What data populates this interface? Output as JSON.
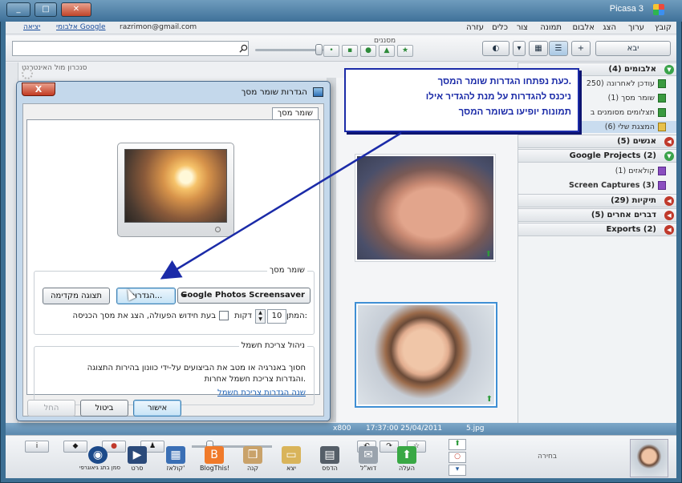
{
  "window": {
    "title": "Picasa 3",
    "min_glyph": "_",
    "max_glyph": "□",
    "close_glyph": "✕"
  },
  "menu": [
    "קובץ",
    "ערוך",
    "הצג",
    "אלבום",
    "תמונה",
    "צור",
    "כלים",
    "עזרה"
  ],
  "account": {
    "email": "razrimon@gmail.com",
    "albums_link": "אלבומי Google",
    "logout_link": "יציאה"
  },
  "toolbar": {
    "filters_label": "מסננים",
    "import_label": "יבא",
    "internet_sync_label": "סנכרון מול האינטרנט"
  },
  "sidebar": {
    "sections": [
      {
        "label": "אלבומים (4)",
        "state": "open"
      },
      {
        "label": "אנשים (5)",
        "state": "closed"
      },
      {
        "label": "Google Projects (2)",
        "state": "open"
      },
      {
        "label": "תיקיות (29)",
        "state": "closed"
      },
      {
        "label": "דברים אחרים (5)",
        "state": "closed"
      },
      {
        "label": "Exports (2)",
        "state": "closed"
      }
    ],
    "albums": [
      {
        "label": "עודכן לאחרונה (250"
      },
      {
        "label": "שומר מסך (1)"
      },
      {
        "label": "תצלומים מסומנים ב"
      },
      {
        "label": "המצגת שלי (6)"
      }
    ],
    "projects": [
      {
        "label": "קולאזים (1)"
      },
      {
        "label": "Screen Captures (3)"
      }
    ]
  },
  "status": {
    "dims": "x800",
    "datetime": "17:37:00 25/04/2011",
    "filename": "5.jpg"
  },
  "bottom": {
    "tray_label": "בחירה",
    "actions": [
      {
        "label": "העלה",
        "icon": "upload-icon",
        "color": "#39a845"
      },
      {
        "label": "דוא\"ל",
        "icon": "email-icon",
        "color": "#9aa3ad"
      },
      {
        "label": "הדפס",
        "icon": "printer-icon",
        "color": "#555e68"
      },
      {
        "label": "יצא",
        "icon": "folder-icon",
        "color": "#d9b45a"
      },
      {
        "label": "קנה",
        "icon": "shop-icon",
        "color": "#c9a26a"
      },
      {
        "label": "BlogThis!",
        "icon": "blogger-icon",
        "color": "#f07a2a"
      },
      {
        "label": "קולאז'",
        "icon": "collage-icon",
        "color": "#3a6fb5"
      },
      {
        "label": "סרט",
        "icon": "movie-icon",
        "color": "#2b4a7a"
      },
      {
        "label": "סמן בתג גיאוגרפי",
        "icon": "geotag-icon",
        "color": "#1c4a8a"
      }
    ]
  },
  "dialog": {
    "title": "הגדרות שומר מסך",
    "close_glyph": "X",
    "tab": "שומר מסך",
    "saver_group": "שומר מסך",
    "saver_value": "Google Photos Screensaver",
    "settings_button": "הגדרות...",
    "preview_button": "תצוגה מקדימה",
    "wait_label": "המתן:",
    "wait_value": "10",
    "minutes_label": "דקות",
    "resume_label": "בעת חידוש הפעולה, הצג את מסך הכניסה",
    "resume_checked": false,
    "power_group": "ניהול צריכת חשמל",
    "power_text": "חסוך באנרגיה או מטב את הביצועים על-ידי כוונון בהירות התצוגה והגדרות צריכת חשמל אחרות.",
    "power_link": "שנה הגדרות צריכת חשמל",
    "ok_button": "אישור",
    "cancel_button": "ביטול",
    "apply_button": "החל"
  },
  "callout": {
    "lines": [
      "כעת נפתחו הגדרות שומר המסך.",
      "ניכנס להגדרות על מנת להגדיר אילו",
      "תמונות יופיעו בשומר המסך"
    ],
    "color": "#1b2ba8"
  }
}
